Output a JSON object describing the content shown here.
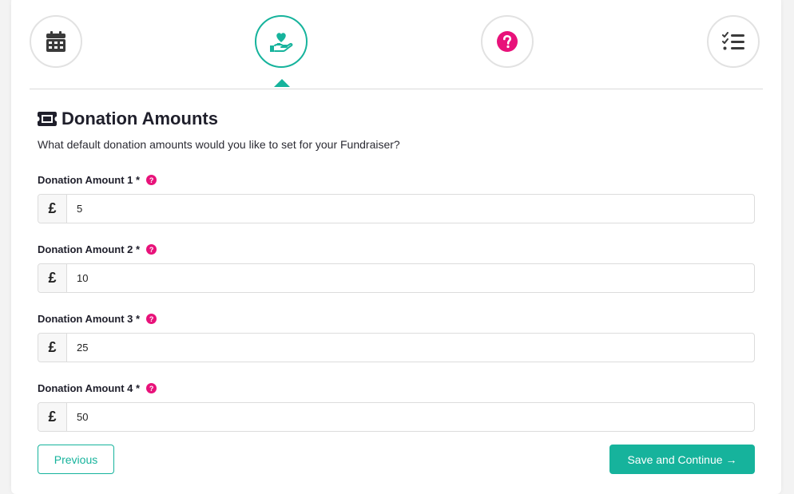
{
  "steps": [
    {
      "icon": "calendar-icon",
      "active": false
    },
    {
      "icon": "donation-hand-heart-icon",
      "active": true
    },
    {
      "icon": "question-circle-icon",
      "active": false
    },
    {
      "icon": "checklist-icon",
      "active": false
    }
  ],
  "section": {
    "title": "Donation Amounts",
    "subtitle": "What default donation amounts would you like to set for your Fundraiser?",
    "title_icon": "ticket-icon"
  },
  "fields": [
    {
      "label": "Donation Amount 1 *",
      "currency": "£",
      "value": "5"
    },
    {
      "label": "Donation Amount 2 *",
      "currency": "£",
      "value": "10"
    },
    {
      "label": "Donation Amount 3 *",
      "currency": "£",
      "value": "25"
    },
    {
      "label": "Donation Amount 4 *",
      "currency": "£",
      "value": "50"
    }
  ],
  "help_glyph": "?",
  "buttons": {
    "previous": "Previous",
    "save": "Save and Continue",
    "save_arrow": "→"
  },
  "colors": {
    "accent": "#16b39c",
    "help": "#e8127a",
    "icon_dark": "#3a3a3a"
  }
}
